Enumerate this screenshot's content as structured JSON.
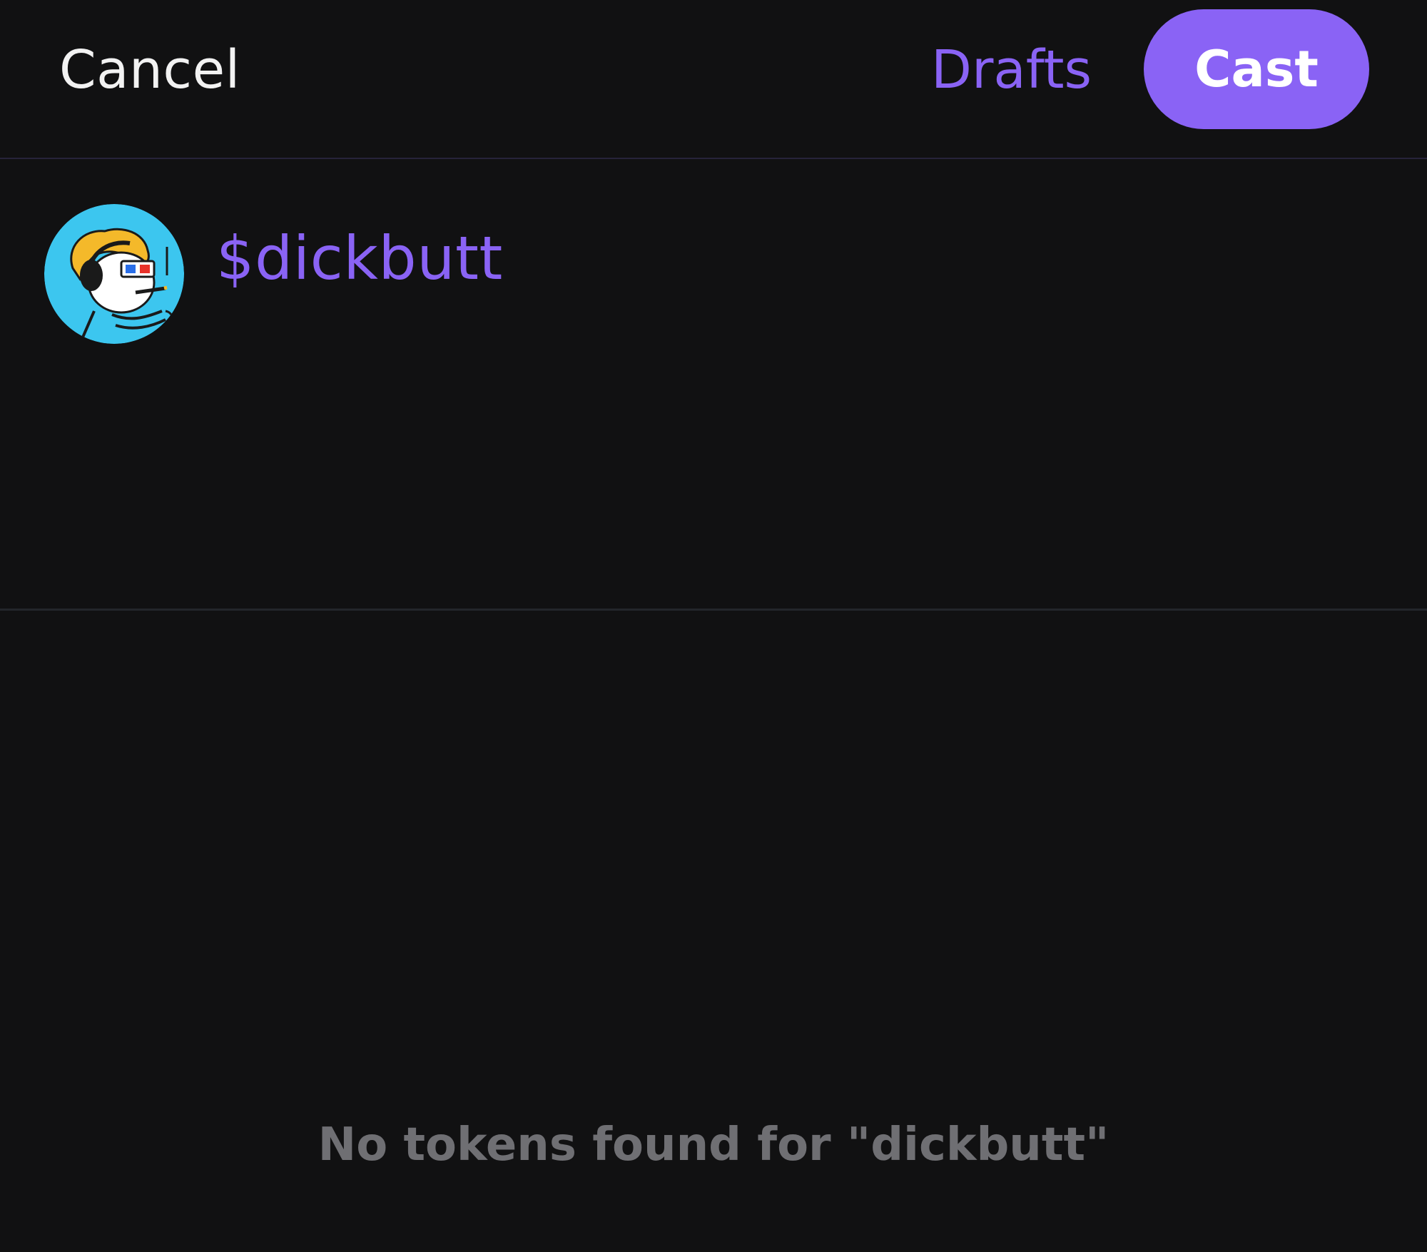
{
  "header": {
    "cancel_label": "Cancel",
    "drafts_label": "Drafts",
    "cast_label": "Cast"
  },
  "composer": {
    "avatar_icon": "cartoon-avatar-icon",
    "text": "$dickbutt"
  },
  "results": {
    "empty_message": "No tokens found for \"dickbutt\""
  },
  "colors": {
    "background": "#111112",
    "accent": "#8a63f5",
    "text_primary": "#f2f2f2",
    "text_muted": "#6f6f73",
    "avatar_bg": "#3cc6ef"
  }
}
